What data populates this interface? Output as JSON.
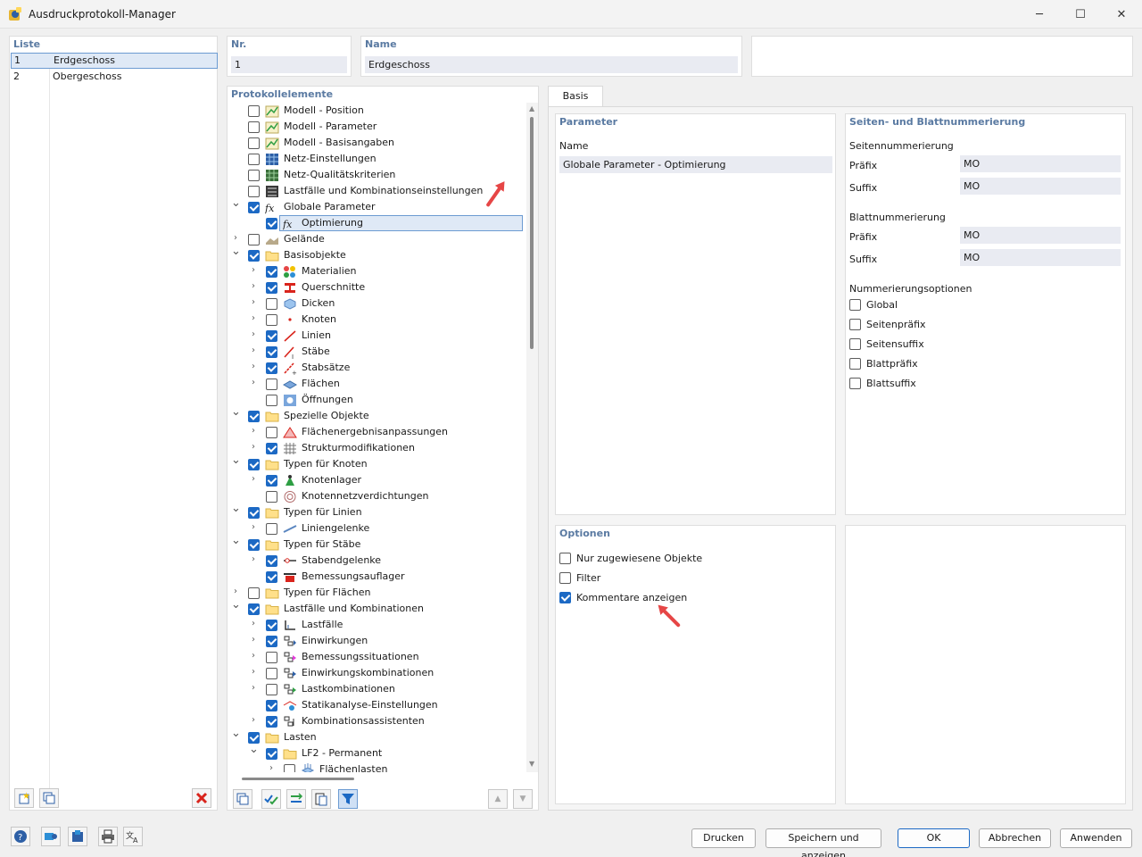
{
  "window": {
    "title": "Ausdruckprotokoll-Manager",
    "min_glyph": "─",
    "max_glyph": "☐",
    "close_glyph": "✕"
  },
  "liste": {
    "header": "Liste",
    "items": [
      {
        "nr": "1",
        "name": "Erdgeschoss"
      },
      {
        "nr": "2",
        "name": "Obergeschoss"
      }
    ]
  },
  "nr": {
    "label": "Nr.",
    "value": "1"
  },
  "name": {
    "label": "Name",
    "value": "Erdgeschoss"
  },
  "tree": {
    "header": "Protokollelemente",
    "rows": [
      {
        "label": "Modell - Position",
        "level": 0,
        "checked": false,
        "expand": "",
        "icon": "model-icon"
      },
      {
        "label": "Modell - Parameter",
        "level": 0,
        "checked": false,
        "expand": "",
        "icon": "model-icon"
      },
      {
        "label": "Modell - Basisangaben",
        "level": 0,
        "checked": false,
        "expand": "",
        "icon": "model-icon"
      },
      {
        "label": "Netz-Einstellungen",
        "level": 0,
        "checked": false,
        "expand": "",
        "icon": "mesh-icon"
      },
      {
        "label": "Netz-Qualitätskriterien",
        "level": 0,
        "checked": false,
        "expand": "",
        "icon": "mesh-quality-icon"
      },
      {
        "label": "Lastfälle und Kombinationseinstellungen",
        "level": 0,
        "checked": false,
        "expand": "",
        "icon": "loadcase-settings-icon"
      },
      {
        "label": "Globale Parameter",
        "level": 0,
        "checked": true,
        "expand": "open",
        "icon": "fx-icon"
      },
      {
        "label": "Optimierung",
        "level": 1,
        "checked": true,
        "expand": "",
        "icon": "fx-icon",
        "selected": true
      },
      {
        "label": "Gelände",
        "level": 0,
        "checked": false,
        "expand": "closed",
        "icon": "terrain-icon"
      },
      {
        "label": "Basisobjekte",
        "level": 0,
        "checked": true,
        "expand": "open",
        "icon": "folder-icon"
      },
      {
        "label": "Materialien",
        "level": 1,
        "checked": true,
        "expand": "closed",
        "icon": "materials-icon"
      },
      {
        "label": "Querschnitte",
        "level": 1,
        "checked": true,
        "expand": "closed",
        "icon": "section-icon"
      },
      {
        "label": "Dicken",
        "level": 1,
        "checked": false,
        "expand": "closed",
        "icon": "thickness-icon"
      },
      {
        "label": "Knoten",
        "level": 1,
        "checked": false,
        "expand": "closed",
        "icon": "node-icon"
      },
      {
        "label": "Linien",
        "level": 1,
        "checked": true,
        "expand": "closed",
        "icon": "line-icon"
      },
      {
        "label": "Stäbe",
        "level": 1,
        "checked": true,
        "expand": "closed",
        "icon": "member-icon"
      },
      {
        "label": "Stabsätze",
        "level": 1,
        "checked": true,
        "expand": "closed",
        "icon": "member-set-icon"
      },
      {
        "label": "Flächen",
        "level": 1,
        "checked": false,
        "expand": "closed",
        "icon": "surface-icon"
      },
      {
        "label": "Öffnungen",
        "level": 1,
        "checked": false,
        "expand": "",
        "icon": "opening-icon"
      },
      {
        "label": "Spezielle Objekte",
        "level": 0,
        "checked": true,
        "expand": "open",
        "icon": "folder-icon"
      },
      {
        "label": "Flächenergebnisanpassungen",
        "level": 1,
        "checked": false,
        "expand": "closed",
        "icon": "surface-result-icon"
      },
      {
        "label": "Strukturmodifikationen",
        "level": 1,
        "checked": true,
        "expand": "closed",
        "icon": "structure-mod-icon"
      },
      {
        "label": "Typen für Knoten",
        "level": 0,
        "checked": true,
        "expand": "open",
        "icon": "folder-icon"
      },
      {
        "label": "Knotenlager",
        "level": 1,
        "checked": true,
        "expand": "closed",
        "icon": "nodal-support-icon"
      },
      {
        "label": "Knotennetzverdichtungen",
        "level": 1,
        "checked": false,
        "expand": "",
        "icon": "mesh-refine-icon"
      },
      {
        "label": "Typen für Linien",
        "level": 0,
        "checked": true,
        "expand": "open",
        "icon": "folder-icon"
      },
      {
        "label": "Liniengelenke",
        "level": 1,
        "checked": false,
        "expand": "closed",
        "icon": "line-hinge-icon"
      },
      {
        "label": "Typen für Stäbe",
        "level": 0,
        "checked": true,
        "expand": "open",
        "icon": "folder-icon"
      },
      {
        "label": "Stabendgelenke",
        "level": 1,
        "checked": true,
        "expand": "closed",
        "icon": "member-hinge-icon"
      },
      {
        "label": "Bemessungsauflager",
        "level": 1,
        "checked": true,
        "expand": "",
        "icon": "design-support-icon"
      },
      {
        "label": "Typen für Flächen",
        "level": 0,
        "checked": false,
        "expand": "closed",
        "icon": "folder-icon"
      },
      {
        "label": "Lastfälle und Kombinationen",
        "level": 0,
        "checked": true,
        "expand": "open",
        "icon": "folder-icon"
      },
      {
        "label": "Lastfälle",
        "level": 1,
        "checked": true,
        "expand": "closed",
        "icon": "loadcase-icon"
      },
      {
        "label": "Einwirkungen",
        "level": 1,
        "checked": true,
        "expand": "closed",
        "icon": "action-icon"
      },
      {
        "label": "Bemessungssituationen",
        "level": 1,
        "checked": false,
        "expand": "closed",
        "icon": "design-situation-icon"
      },
      {
        "label": "Einwirkungskombinationen",
        "level": 1,
        "checked": false,
        "expand": "closed",
        "icon": "action-combo-icon"
      },
      {
        "label": "Lastkombinationen",
        "level": 1,
        "checked": false,
        "expand": "closed",
        "icon": "load-combo-icon"
      },
      {
        "label": "Statikanalyse-Einstellungen",
        "level": 1,
        "checked": true,
        "expand": "",
        "icon": "analysis-settings-icon"
      },
      {
        "label": "Kombinationsassistenten",
        "level": 1,
        "checked": true,
        "expand": "closed",
        "icon": "combo-wizard-icon"
      },
      {
        "label": "Lasten",
        "level": 0,
        "checked": true,
        "expand": "open",
        "icon": "folder-icon"
      },
      {
        "label": "LF2 - Permanent",
        "level": 1,
        "checked": true,
        "expand": "open",
        "icon": "folder-icon"
      },
      {
        "label": "Flächenlasten",
        "level": 2,
        "checked": false,
        "expand": "closed",
        "icon": "surface-load-icon"
      }
    ]
  },
  "tabs": [
    {
      "label": "Basis"
    }
  ],
  "parameter": {
    "header": "Parameter",
    "name_label": "Name",
    "name_value": "Globale Parameter - Optimierung"
  },
  "numbering": {
    "header": "Seiten- und Blattnummerierung",
    "page_header": "Seitennummerierung",
    "page_prefix_label": "Präfix",
    "page_prefix_value": "MO",
    "page_suffix_label": "Suffix",
    "page_suffix_value": "MO",
    "sheet_header": "Blattnummerierung",
    "sheet_prefix_label": "Präfix",
    "sheet_prefix_value": "MO",
    "sheet_suffix_label": "Suffix",
    "sheet_suffix_value": "MO",
    "options_header": "Nummerierungsoptionen",
    "options": [
      {
        "label": "Global",
        "checked": false
      },
      {
        "label": "Seitenpräfix",
        "checked": false
      },
      {
        "label": "Seitensuffix",
        "checked": false
      },
      {
        "label": "Blattpräfix",
        "checked": false
      },
      {
        "label": "Blattsuffix",
        "checked": false
      }
    ]
  },
  "options": {
    "header": "Optionen",
    "items": [
      {
        "label": "Nur zugewiesene Objekte",
        "checked": false
      },
      {
        "label": "Filter",
        "checked": false
      },
      {
        "label": "Kommentare anzeigen",
        "checked": true
      }
    ]
  },
  "buttons": {
    "print": "Drucken",
    "save_show": "Speichern und anzeigen",
    "ok": "OK",
    "cancel": "Abbrechen",
    "apply": "Anwenden"
  },
  "colors": {
    "accent": "#1c69c4",
    "header_text": "#5a7aa2",
    "arrow": "#e64646",
    "delete": "#d9241c"
  }
}
